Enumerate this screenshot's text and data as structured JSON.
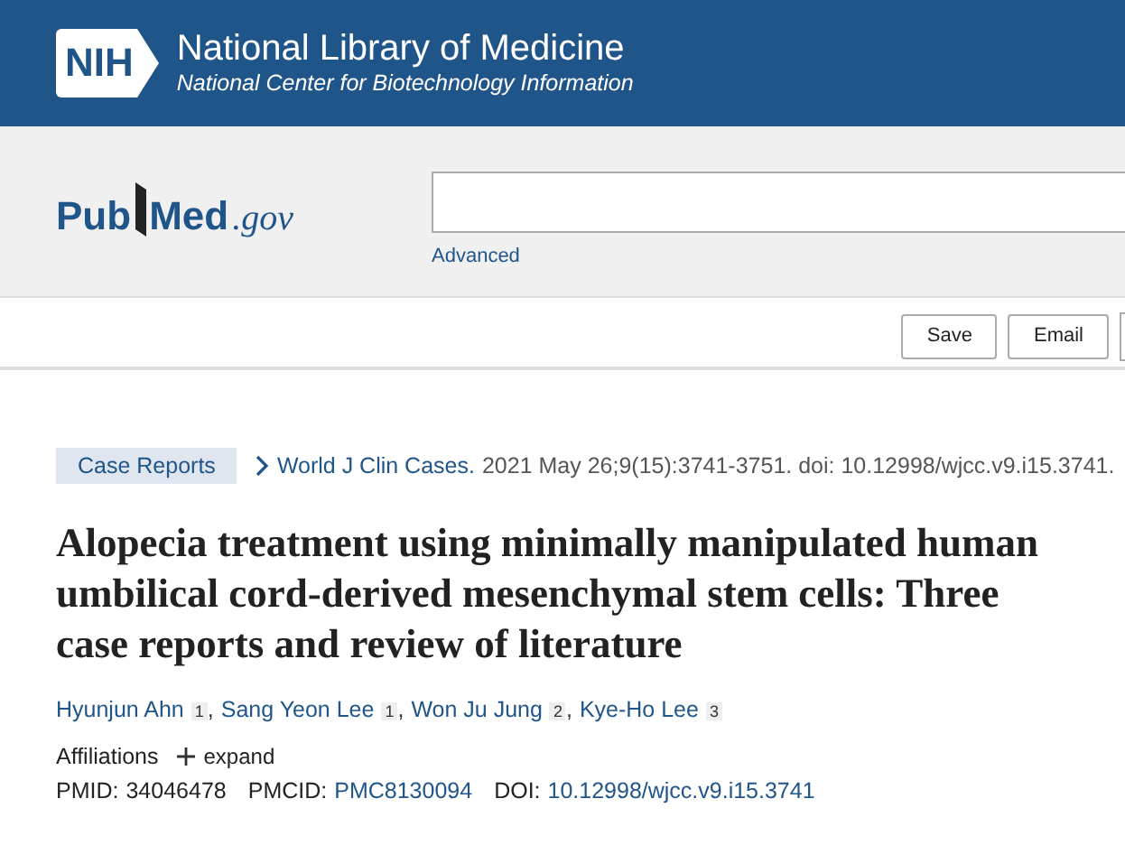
{
  "header": {
    "title": "National Library of Medicine",
    "subtitle": "National Center for Biotechnology Information",
    "badge": "NIH"
  },
  "search": {
    "logo_main": "Pub",
    "logo_med": "Med",
    "logo_suffix": ".gov",
    "advanced_link": "Advanced"
  },
  "actions": [
    "Save",
    "Email"
  ],
  "article": {
    "type_tag": "Case Reports",
    "journal": "World J Clin Cases.",
    "citation": "2021 May 26;9(15):3741-3751. doi: 10.12998/wjcc.v9.i15.3741.",
    "title": "Alopecia treatment using minimally manipulated human umbilical cord-derived mesenchymal stem cells: Three case reports and review of literature",
    "authors": [
      {
        "name": "Hyunjun Ahn",
        "mark": "1"
      },
      {
        "name": "Sang Yeon Lee",
        "mark": "1"
      },
      {
        "name": "Won Ju Jung",
        "mark": "2"
      },
      {
        "name": "Kye-Ho Lee",
        "mark": "3"
      }
    ],
    "author_separator": ",",
    "affiliations_label": "Affiliations",
    "expand_label": "expand",
    "ids": [
      {
        "label": "PMID:",
        "value": "34046478",
        "link": false
      },
      {
        "label": "PMCID:",
        "value": "PMC8130094",
        "link": true
      },
      {
        "label": "DOI:",
        "value": "10.12998/wjcc.v9.i15.3741",
        "link": true
      }
    ]
  }
}
